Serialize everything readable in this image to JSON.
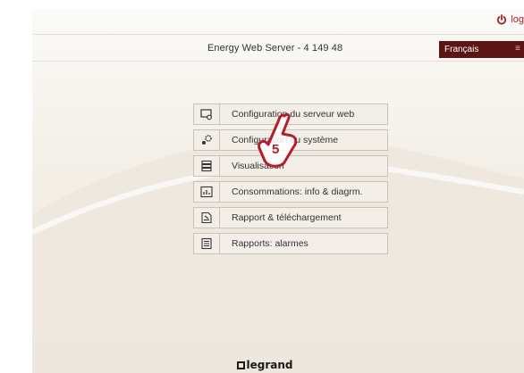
{
  "header": {
    "logout_label": "log",
    "server_title": "Energy Web Server - 4 149 48",
    "language_selected": "Français",
    "language_suffix": "≡"
  },
  "menu": {
    "items": [
      {
        "label": "Configuration du serveur web",
        "icon": "monitor-gear-icon"
      },
      {
        "label": "Configuration du système",
        "icon": "gears-icon"
      },
      {
        "label": "Visualisation",
        "icon": "stack-icon"
      },
      {
        "label": "Consommations: info & diagrm.",
        "icon": "chart-icon"
      },
      {
        "label": "Rapport & téléchargement",
        "icon": "document-download-icon"
      },
      {
        "label": "Rapports: alarmes",
        "icon": "list-document-icon"
      }
    ]
  },
  "annotation": {
    "step_number": "5"
  },
  "footer": {
    "brand": "legrand"
  },
  "colors": {
    "accent": "#a3232d",
    "language_bg": "#5c1313",
    "page_bg": "#f3efe7"
  }
}
